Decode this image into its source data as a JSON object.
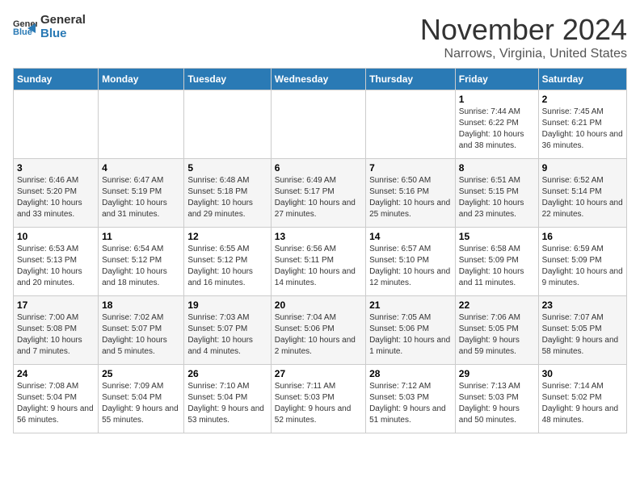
{
  "logo": {
    "text_general": "General",
    "text_blue": "Blue"
  },
  "header": {
    "month": "November 2024",
    "location": "Narrows, Virginia, United States"
  },
  "weekdays": [
    "Sunday",
    "Monday",
    "Tuesday",
    "Wednesday",
    "Thursday",
    "Friday",
    "Saturday"
  ],
  "weeks": [
    [
      {
        "day": "",
        "sunrise": "",
        "sunset": "",
        "daylight": ""
      },
      {
        "day": "",
        "sunrise": "",
        "sunset": "",
        "daylight": ""
      },
      {
        "day": "",
        "sunrise": "",
        "sunset": "",
        "daylight": ""
      },
      {
        "day": "",
        "sunrise": "",
        "sunset": "",
        "daylight": ""
      },
      {
        "day": "",
        "sunrise": "",
        "sunset": "",
        "daylight": ""
      },
      {
        "day": "1",
        "sunrise": "Sunrise: 7:44 AM",
        "sunset": "Sunset: 6:22 PM",
        "daylight": "Daylight: 10 hours and 38 minutes."
      },
      {
        "day": "2",
        "sunrise": "Sunrise: 7:45 AM",
        "sunset": "Sunset: 6:21 PM",
        "daylight": "Daylight: 10 hours and 36 minutes."
      }
    ],
    [
      {
        "day": "3",
        "sunrise": "Sunrise: 6:46 AM",
        "sunset": "Sunset: 5:20 PM",
        "daylight": "Daylight: 10 hours and 33 minutes."
      },
      {
        "day": "4",
        "sunrise": "Sunrise: 6:47 AM",
        "sunset": "Sunset: 5:19 PM",
        "daylight": "Daylight: 10 hours and 31 minutes."
      },
      {
        "day": "5",
        "sunrise": "Sunrise: 6:48 AM",
        "sunset": "Sunset: 5:18 PM",
        "daylight": "Daylight: 10 hours and 29 minutes."
      },
      {
        "day": "6",
        "sunrise": "Sunrise: 6:49 AM",
        "sunset": "Sunset: 5:17 PM",
        "daylight": "Daylight: 10 hours and 27 minutes."
      },
      {
        "day": "7",
        "sunrise": "Sunrise: 6:50 AM",
        "sunset": "Sunset: 5:16 PM",
        "daylight": "Daylight: 10 hours and 25 minutes."
      },
      {
        "day": "8",
        "sunrise": "Sunrise: 6:51 AM",
        "sunset": "Sunset: 5:15 PM",
        "daylight": "Daylight: 10 hours and 23 minutes."
      },
      {
        "day": "9",
        "sunrise": "Sunrise: 6:52 AM",
        "sunset": "Sunset: 5:14 PM",
        "daylight": "Daylight: 10 hours and 22 minutes."
      }
    ],
    [
      {
        "day": "10",
        "sunrise": "Sunrise: 6:53 AM",
        "sunset": "Sunset: 5:13 PM",
        "daylight": "Daylight: 10 hours and 20 minutes."
      },
      {
        "day": "11",
        "sunrise": "Sunrise: 6:54 AM",
        "sunset": "Sunset: 5:12 PM",
        "daylight": "Daylight: 10 hours and 18 minutes."
      },
      {
        "day": "12",
        "sunrise": "Sunrise: 6:55 AM",
        "sunset": "Sunset: 5:12 PM",
        "daylight": "Daylight: 10 hours and 16 minutes."
      },
      {
        "day": "13",
        "sunrise": "Sunrise: 6:56 AM",
        "sunset": "Sunset: 5:11 PM",
        "daylight": "Daylight: 10 hours and 14 minutes."
      },
      {
        "day": "14",
        "sunrise": "Sunrise: 6:57 AM",
        "sunset": "Sunset: 5:10 PM",
        "daylight": "Daylight: 10 hours and 12 minutes."
      },
      {
        "day": "15",
        "sunrise": "Sunrise: 6:58 AM",
        "sunset": "Sunset: 5:09 PM",
        "daylight": "Daylight: 10 hours and 11 minutes."
      },
      {
        "day": "16",
        "sunrise": "Sunrise: 6:59 AM",
        "sunset": "Sunset: 5:09 PM",
        "daylight": "Daylight: 10 hours and 9 minutes."
      }
    ],
    [
      {
        "day": "17",
        "sunrise": "Sunrise: 7:00 AM",
        "sunset": "Sunset: 5:08 PM",
        "daylight": "Daylight: 10 hours and 7 minutes."
      },
      {
        "day": "18",
        "sunrise": "Sunrise: 7:02 AM",
        "sunset": "Sunset: 5:07 PM",
        "daylight": "Daylight: 10 hours and 5 minutes."
      },
      {
        "day": "19",
        "sunrise": "Sunrise: 7:03 AM",
        "sunset": "Sunset: 5:07 PM",
        "daylight": "Daylight: 10 hours and 4 minutes."
      },
      {
        "day": "20",
        "sunrise": "Sunrise: 7:04 AM",
        "sunset": "Sunset: 5:06 PM",
        "daylight": "Daylight: 10 hours and 2 minutes."
      },
      {
        "day": "21",
        "sunrise": "Sunrise: 7:05 AM",
        "sunset": "Sunset: 5:06 PM",
        "daylight": "Daylight: 10 hours and 1 minute."
      },
      {
        "day": "22",
        "sunrise": "Sunrise: 7:06 AM",
        "sunset": "Sunset: 5:05 PM",
        "daylight": "Daylight: 9 hours and 59 minutes."
      },
      {
        "day": "23",
        "sunrise": "Sunrise: 7:07 AM",
        "sunset": "Sunset: 5:05 PM",
        "daylight": "Daylight: 9 hours and 58 minutes."
      }
    ],
    [
      {
        "day": "24",
        "sunrise": "Sunrise: 7:08 AM",
        "sunset": "Sunset: 5:04 PM",
        "daylight": "Daylight: 9 hours and 56 minutes."
      },
      {
        "day": "25",
        "sunrise": "Sunrise: 7:09 AM",
        "sunset": "Sunset: 5:04 PM",
        "daylight": "Daylight: 9 hours and 55 minutes."
      },
      {
        "day": "26",
        "sunrise": "Sunrise: 7:10 AM",
        "sunset": "Sunset: 5:04 PM",
        "daylight": "Daylight: 9 hours and 53 minutes."
      },
      {
        "day": "27",
        "sunrise": "Sunrise: 7:11 AM",
        "sunset": "Sunset: 5:03 PM",
        "daylight": "Daylight: 9 hours and 52 minutes."
      },
      {
        "day": "28",
        "sunrise": "Sunrise: 7:12 AM",
        "sunset": "Sunset: 5:03 PM",
        "daylight": "Daylight: 9 hours and 51 minutes."
      },
      {
        "day": "29",
        "sunrise": "Sunrise: 7:13 AM",
        "sunset": "Sunset: 5:03 PM",
        "daylight": "Daylight: 9 hours and 50 minutes."
      },
      {
        "day": "30",
        "sunrise": "Sunrise: 7:14 AM",
        "sunset": "Sunset: 5:02 PM",
        "daylight": "Daylight: 9 hours and 48 minutes."
      }
    ]
  ]
}
